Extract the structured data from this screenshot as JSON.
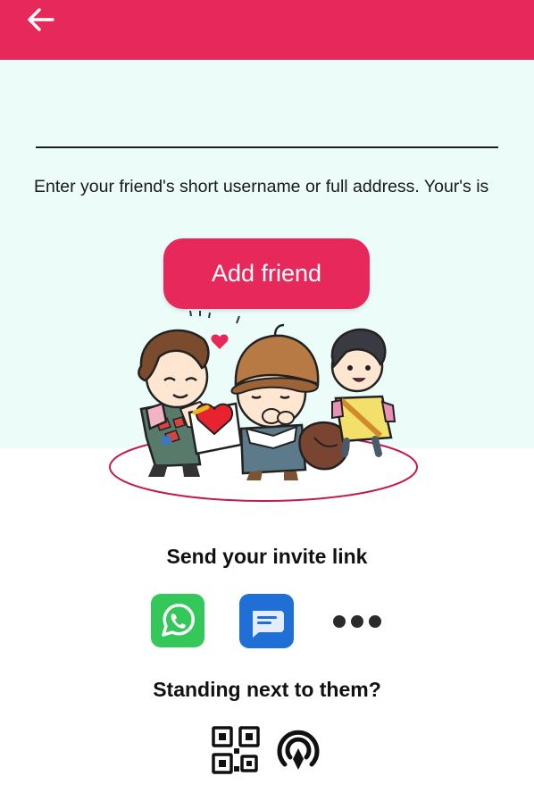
{
  "colors": {
    "accent": "#e7285a",
    "panel_bg": "#ebfcf9"
  },
  "appbar": {
    "back_icon": "arrow-back-icon"
  },
  "form": {
    "username_value": "",
    "helper_text": "Enter your friend's short username or full address. Your's is",
    "add_friend_label": "Add friend"
  },
  "invite": {
    "title": "Send your invite link",
    "options": [
      "whatsapp-icon",
      "messages-icon",
      "more-horiz-icon"
    ]
  },
  "nearby": {
    "title": "Standing next to them?",
    "options": [
      "qr-code-icon",
      "nearby-share-icon"
    ]
  }
}
